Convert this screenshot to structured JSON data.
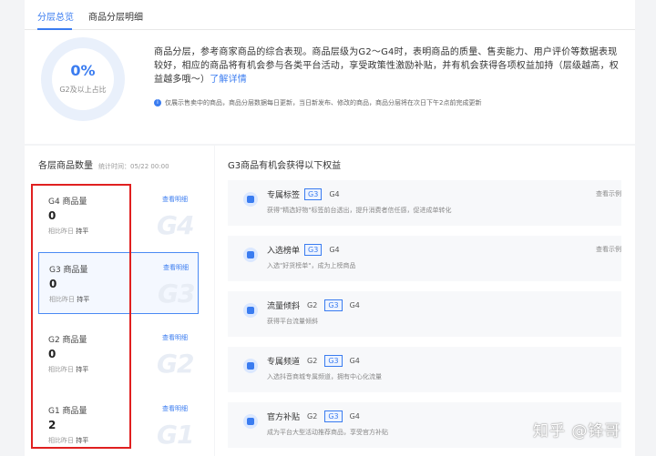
{
  "tabs": [
    {
      "label": "分层总览",
      "active": true
    },
    {
      "label": "商品分层明细",
      "active": false
    }
  ],
  "overview": {
    "percent": "0%",
    "percent_label": "G2及以上占比",
    "description": "商品分层，参考商家商品的综合表现。商品层级为G2～G4时，表明商品的质量、售卖能力、用户评价等数据表现较好，相应的商品将有机会参与各类平台活动，享受政策性激励补贴，并有机会获得各项权益加持（层级越高，权益越多哦～）",
    "link_label": "了解详情",
    "note": "仅展示售卖中的商品，商品分层数据每日更新，当日新发布、修改的商品，商品分层将在次日下午2点前完成更新"
  },
  "tier_section": {
    "title": "各层商品数量",
    "time": "统计时间：05/22 00:00",
    "items": [
      {
        "label": "G4 商品量",
        "value": "0",
        "cmp_label": "相比昨日",
        "cmp_value": "持平",
        "link": "查看明细",
        "mark": "G4",
        "selected": false
      },
      {
        "label": "G3 商品量",
        "value": "0",
        "cmp_label": "相比昨日",
        "cmp_value": "持平",
        "link": "查看明细",
        "mark": "G3",
        "selected": true
      },
      {
        "label": "G2 商品量",
        "value": "0",
        "cmp_label": "相比昨日",
        "cmp_value": "持平",
        "link": "查看明细",
        "mark": "G2",
        "selected": false
      },
      {
        "label": "G1 商品量",
        "value": "2",
        "cmp_label": "相比昨日",
        "cmp_value": "持平",
        "link": "查看明细",
        "mark": "G1",
        "selected": false
      }
    ]
  },
  "benefit_section": {
    "title": "G3商品有机会获得以下权益",
    "items": [
      {
        "icon": "tag-icon",
        "title": "专属标签",
        "tags": [
          {
            "t": "G3",
            "hl": true
          },
          {
            "t": "G4",
            "hl": false
          }
        ],
        "desc": "获得\"精选好物\"标签前台透出，提升消费者信任感，促进成单转化",
        "link": "查看示例"
      },
      {
        "icon": "list-icon",
        "title": "入选榜单",
        "tags": [
          {
            "t": "G3",
            "hl": true
          },
          {
            "t": "G4",
            "hl": false
          }
        ],
        "desc": "入选\"好货榜单\"，成为上榜商品",
        "link": "查看示例"
      },
      {
        "icon": "traffic-icon",
        "title": "流量倾斜",
        "tags": [
          {
            "t": "G2",
            "hl": false
          },
          {
            "t": "G3",
            "hl": true
          },
          {
            "t": "G4",
            "hl": false
          }
        ],
        "desc": "获得平台流量倾斜",
        "link": ""
      },
      {
        "icon": "channel-icon",
        "title": "专属频道",
        "tags": [
          {
            "t": "G2",
            "hl": false
          },
          {
            "t": "G3",
            "hl": true
          },
          {
            "t": "G4",
            "hl": false
          }
        ],
        "desc": "入选抖音商城专属频道，拥有中心化流量",
        "link": ""
      },
      {
        "icon": "subsidy-icon",
        "title": "官方补贴",
        "tags": [
          {
            "t": "G2",
            "hl": false
          },
          {
            "t": "G3",
            "hl": true
          },
          {
            "t": "G4",
            "hl": false
          }
        ],
        "desc": "成为平台大型活动推荐商品，享受官方补贴",
        "link": ""
      }
    ]
  },
  "watermark": "知乎 @锋哥",
  "colors": {
    "accent": "#3a7cf0",
    "highlight_box": "#e02020"
  }
}
